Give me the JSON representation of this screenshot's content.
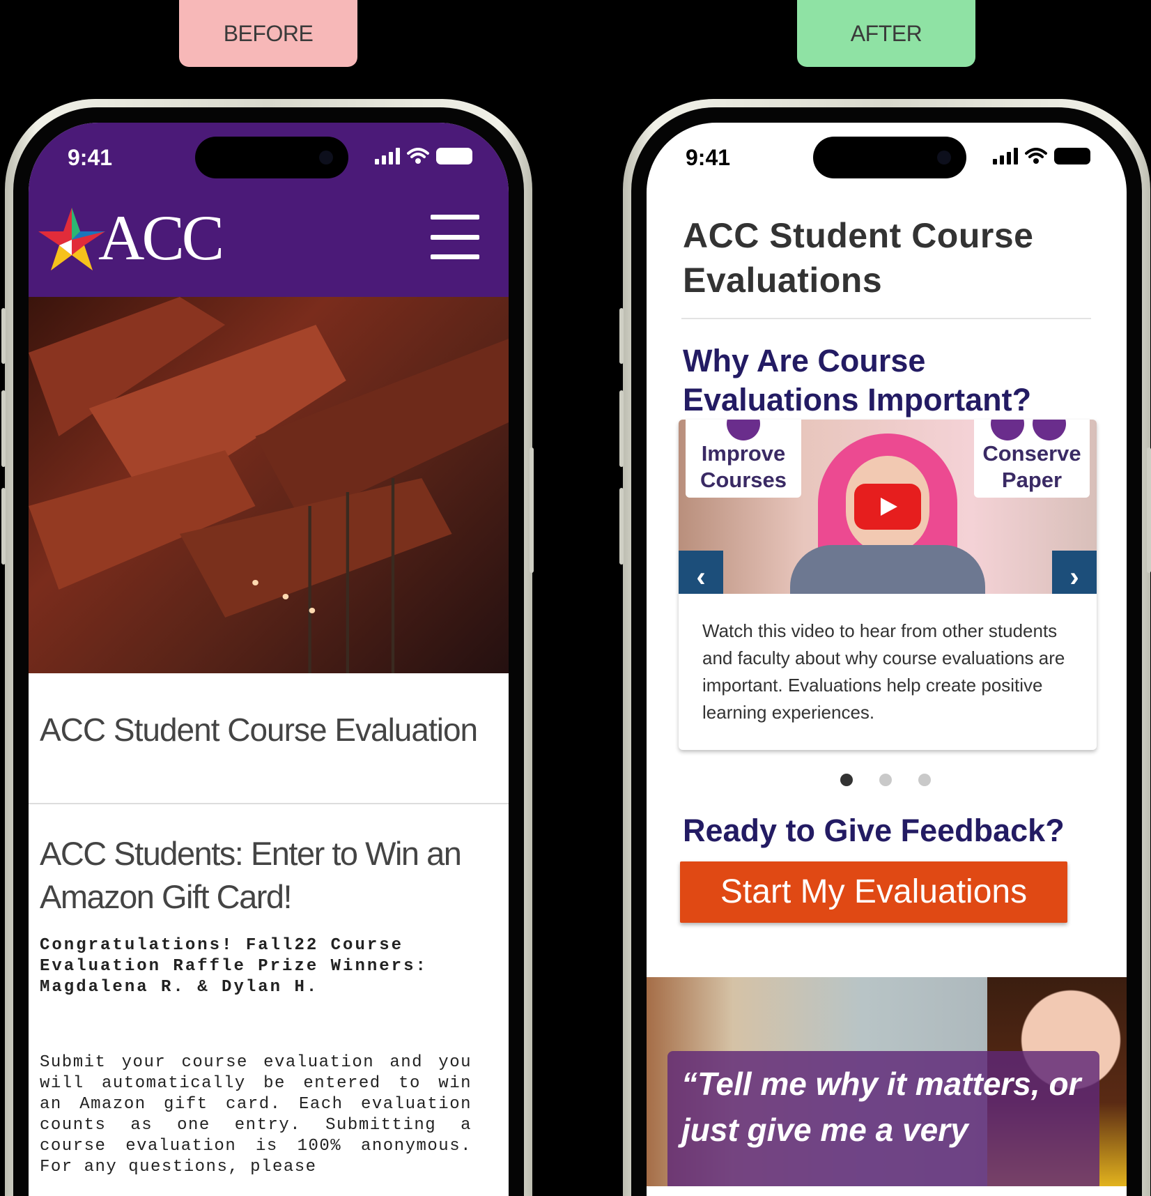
{
  "labels": {
    "before": "BEFORE",
    "after": "AFTER"
  },
  "colors": {
    "acc_purple": "#4b1a78",
    "heading_navy": "#231b63",
    "cta_orange": "#e04914",
    "carousel_blue": "#1c4e7a"
  },
  "before_screen": {
    "status_time": "9:41",
    "logo_text": "ACC",
    "page_title": "ACC Student Course Evaluation",
    "heading": "ACC Students: Enter to Win an Amazon Gift Card!",
    "congrats": "Congratulations! Fall22 Course Evaluation Raffle Prize Winners: Magdalena R. & Dylan H.",
    "body": "Submit your course evaluation and you will automatically be entered to win an Amazon gift card. Each evaluation counts as one entry. Submitting a course evaluation is 100% anonymous. For any questions, please"
  },
  "after_screen": {
    "status_time": "9:41",
    "page_title": "ACC Student Course Evaluations",
    "section_why": "Why Are Course Evaluations Important?",
    "carousel": {
      "tag_left": "Improve Courses",
      "tag_right": "Conserve Paper",
      "prev_label": "‹",
      "next_label": "›",
      "caption": "Watch this video to hear from other students and faculty about why course evaluations are important. Evaluations help create positive learning experiences.",
      "slides_total": 3,
      "active_slide": 1
    },
    "section_ready": "Ready to Give Feedback?",
    "cta_label": "Start My Evaluations",
    "banner_quote": "“Tell me why it matters, or just give me a very"
  }
}
